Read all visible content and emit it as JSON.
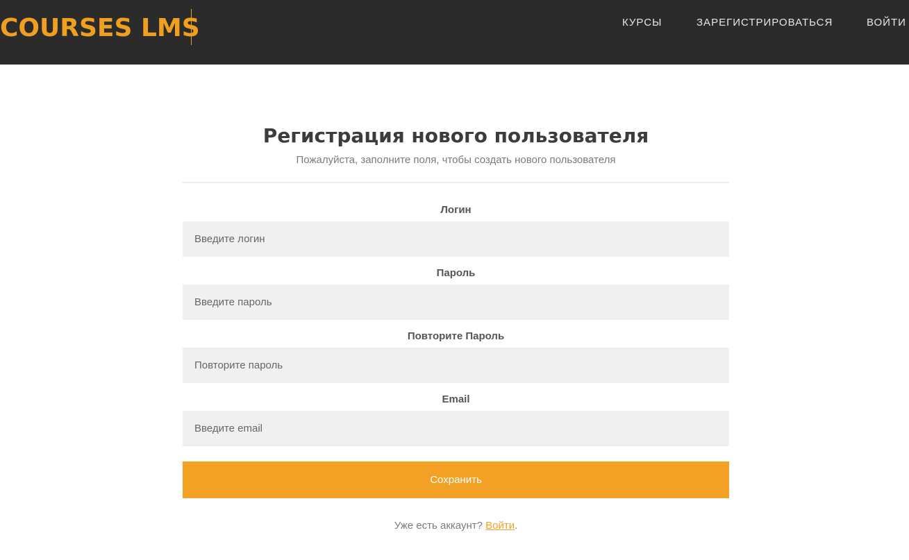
{
  "header": {
    "brand": "COURSES LMS",
    "nav": {
      "courses": "КУРСЫ",
      "register": "ЗАРЕГИСТРИРОВАТЬСЯ",
      "login": "ВОЙТИ"
    }
  },
  "form": {
    "title": "Регистрация нового пользователя",
    "subtitle": "Пожалуйста, заполните поля, чтобы создать нового пользователя",
    "fields": {
      "login": {
        "label": "Логин",
        "placeholder": "Введите логин",
        "value": ""
      },
      "password": {
        "label": "Пароль",
        "placeholder": "Введите пароль",
        "value": ""
      },
      "password_repeat": {
        "label": "Повторите Пароль",
        "placeholder": "Повторите пароль",
        "value": ""
      },
      "email": {
        "label": "Email",
        "placeholder": "Введите email",
        "value": ""
      }
    },
    "submit_label": "Сохранить",
    "footer": {
      "text": "Уже есть аккаунт?",
      "link": "Войти",
      "end": "."
    }
  },
  "colors": {
    "accent": "#f2a124",
    "header_bg": "#2b2b2b",
    "input_bg": "#f0f0f0"
  }
}
